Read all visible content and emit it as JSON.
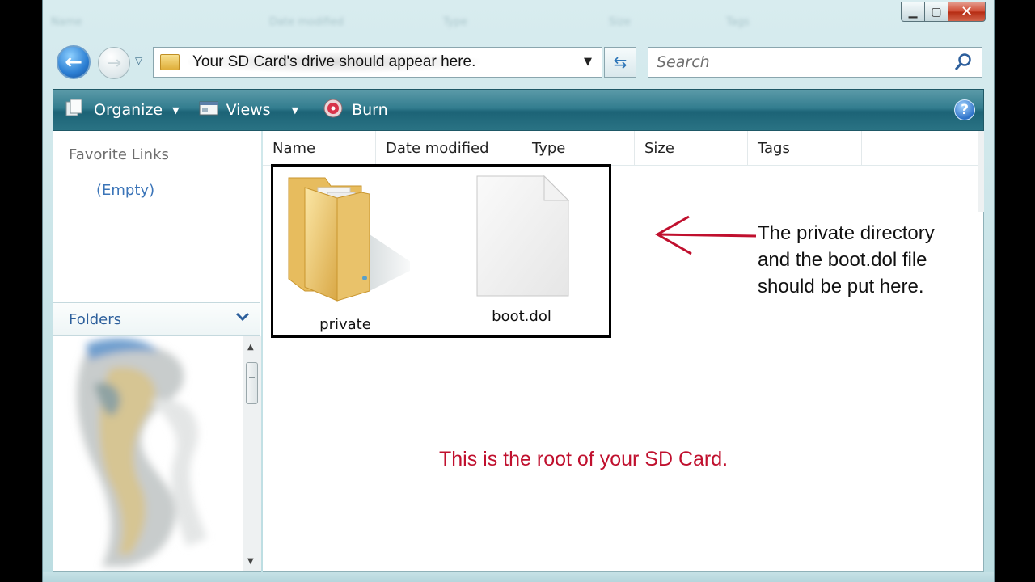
{
  "background_header": [
    "Name",
    "Date modified",
    "Type",
    "Size",
    "Tags"
  ],
  "nav": {
    "address_text": "Your SD Card's drive should appear here.",
    "search_placeholder": "Search"
  },
  "toolbar": {
    "organize_label": "Organize",
    "views_label": "Views",
    "burn_label": "Burn"
  },
  "sidebar": {
    "favorite_links_title": "Favorite Links",
    "favorite_links_empty": "(Empty)",
    "folders_title": "Folders"
  },
  "columns": [
    "Name",
    "Date modified",
    "Type",
    "Size",
    "Tags"
  ],
  "files": [
    {
      "name": "private",
      "icon": "folder-icon"
    },
    {
      "name": "boot.dol",
      "icon": "file-icon"
    }
  ],
  "annotation": {
    "lines": [
      "The private directory",
      "and the boot.dol file",
      "should be put here."
    ],
    "arrow_color": "#c0102e"
  },
  "root_caption": "This is the root of your SD Card.",
  "colors": {
    "toolbar": "#2a7384",
    "caption_red": "#c0102e",
    "link_blue": "#3a74b8"
  }
}
